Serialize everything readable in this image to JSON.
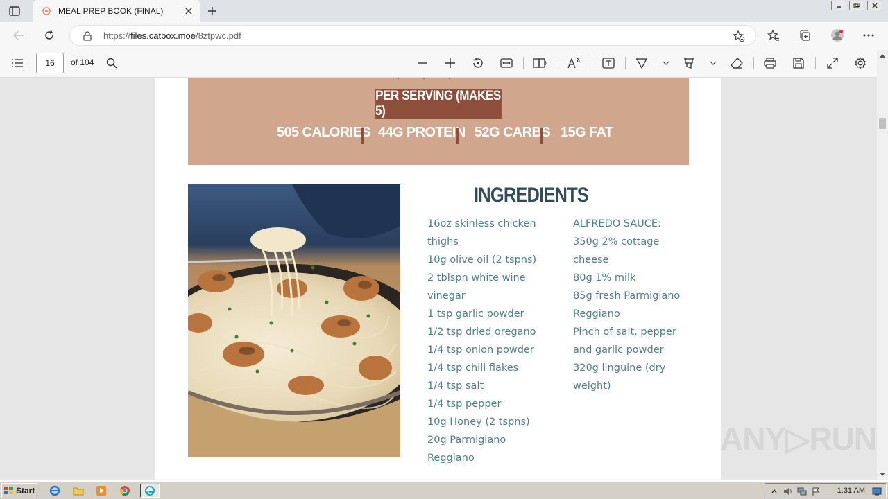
{
  "browser": {
    "tab_title": "MEAL PREP BOOK (FINAL)",
    "url_prefix": "https://",
    "url_host": "files.catbox.moe",
    "url_path": "/8ztpwc.pdf"
  },
  "pdf_toolbar": {
    "current_page": "16",
    "page_total_label": "of 104"
  },
  "nutrition": {
    "serving_label": "PER SERVING (MAKES 5)",
    "calories": "505 CALORIES",
    "protein": "44G PROTEIN",
    "carbs": "52G CARBS",
    "fat": "15G FAT"
  },
  "ingredients": {
    "title": "INGREDIENTS",
    "col1": [
      "16oz skinless chicken",
      "thighs",
      "10g olive oil (2 tspns)",
      "2 tblspn white wine",
      "vinegar",
      "1 tsp garlic powder",
      "1/2 tsp dried oregano",
      "1/4 tsp onion powder",
      "1/4 tsp chili flakes",
      "1/4 tsp salt",
      "1/4 tsp pepper",
      "10g Honey (2 tspns)",
      "20g Parmigiano",
      "Reggiano"
    ],
    "col2": [
      "ALFREDO SAUCE:",
      "350g 2% cottage",
      "cheese",
      "80g 1% milk",
      "85g fresh Parmigiano",
      "Reggiano",
      "Pinch of salt, pepper",
      "and garlic powder",
      "320g linguine (dry",
      "weight)"
    ]
  },
  "watermark": "ANY▷RUN",
  "taskbar": {
    "start_label": "Start",
    "clock": "1:31 AM"
  },
  "colors": {
    "nutrition_bg": "#d0a68c",
    "accent_brown": "#8d4e3c",
    "title_teal": "#2f4d5a",
    "text_teal": "#4f8088"
  },
  "icons": [
    "tab-actions-icon",
    "favicon-icon",
    "close-icon",
    "plus-icon",
    "back-icon",
    "refresh-icon",
    "lock-icon",
    "add-favorite-icon",
    "favorites-icon",
    "collections-icon",
    "profile-icon",
    "more-icon",
    "contents-icon",
    "search-icon",
    "zoom-out-icon",
    "zoom-in-icon",
    "rotate-icon",
    "fit-icon",
    "page-view-icon",
    "read-aloud-icon",
    "text-icon",
    "draw-icon",
    "highlight-icon",
    "erase-icon",
    "print-icon",
    "save-icon",
    "fullscreen-icon",
    "settings-icon"
  ]
}
